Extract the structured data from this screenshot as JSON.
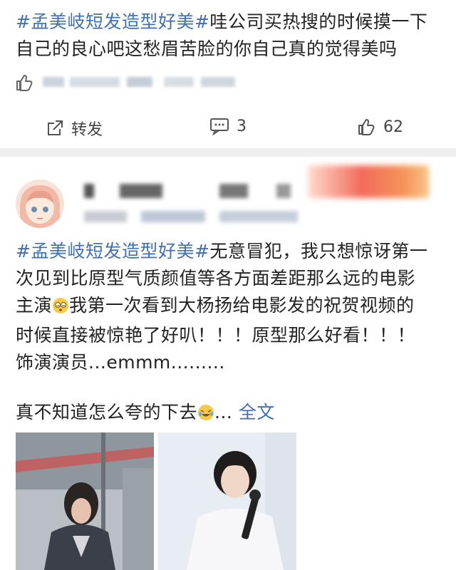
{
  "post1": {
    "hashtag": "#孟美岐短发造型好美#",
    "text_line1_rest": "哇公司买热搜的时候摸一下",
    "text_line2": "自己的良心吧这愁眉苦脸的你自己真的觉得美吗"
  },
  "actions": {
    "repost_label": "转发",
    "comment_count": "3",
    "like_count": "62"
  },
  "post2": {
    "line1_hashtag": "#孟美岐短发造型好美#",
    "line1_rest": "无意冒犯，我只想惊讶第一",
    "line2": "次见到比原型气质颜值等各方面差距那么远的电影",
    "line3_a": "主演",
    "line3_b": "我第一次看到大杨扬给电影发的祝贺视频的",
    "line4": "时候直接被惊艳了好叭！！！原型那么好看！！！",
    "line5": "饰演演员...emmm.........",
    "tail_text": "真不知道怎么夸的下去",
    "ellipsis": "...",
    "full_text_link": "全文"
  },
  "icons": {
    "like": "thumbs-up-icon",
    "repost": "share-square-icon",
    "comment": "comment-bubble-icon",
    "emoji_dizzy": "dizzy-face-emoji",
    "emoji_laugh": "laughing-tears-emoji"
  },
  "colors": {
    "hashtag": "#3e6fb5",
    "text": "#222222",
    "divider": "#efefef"
  }
}
